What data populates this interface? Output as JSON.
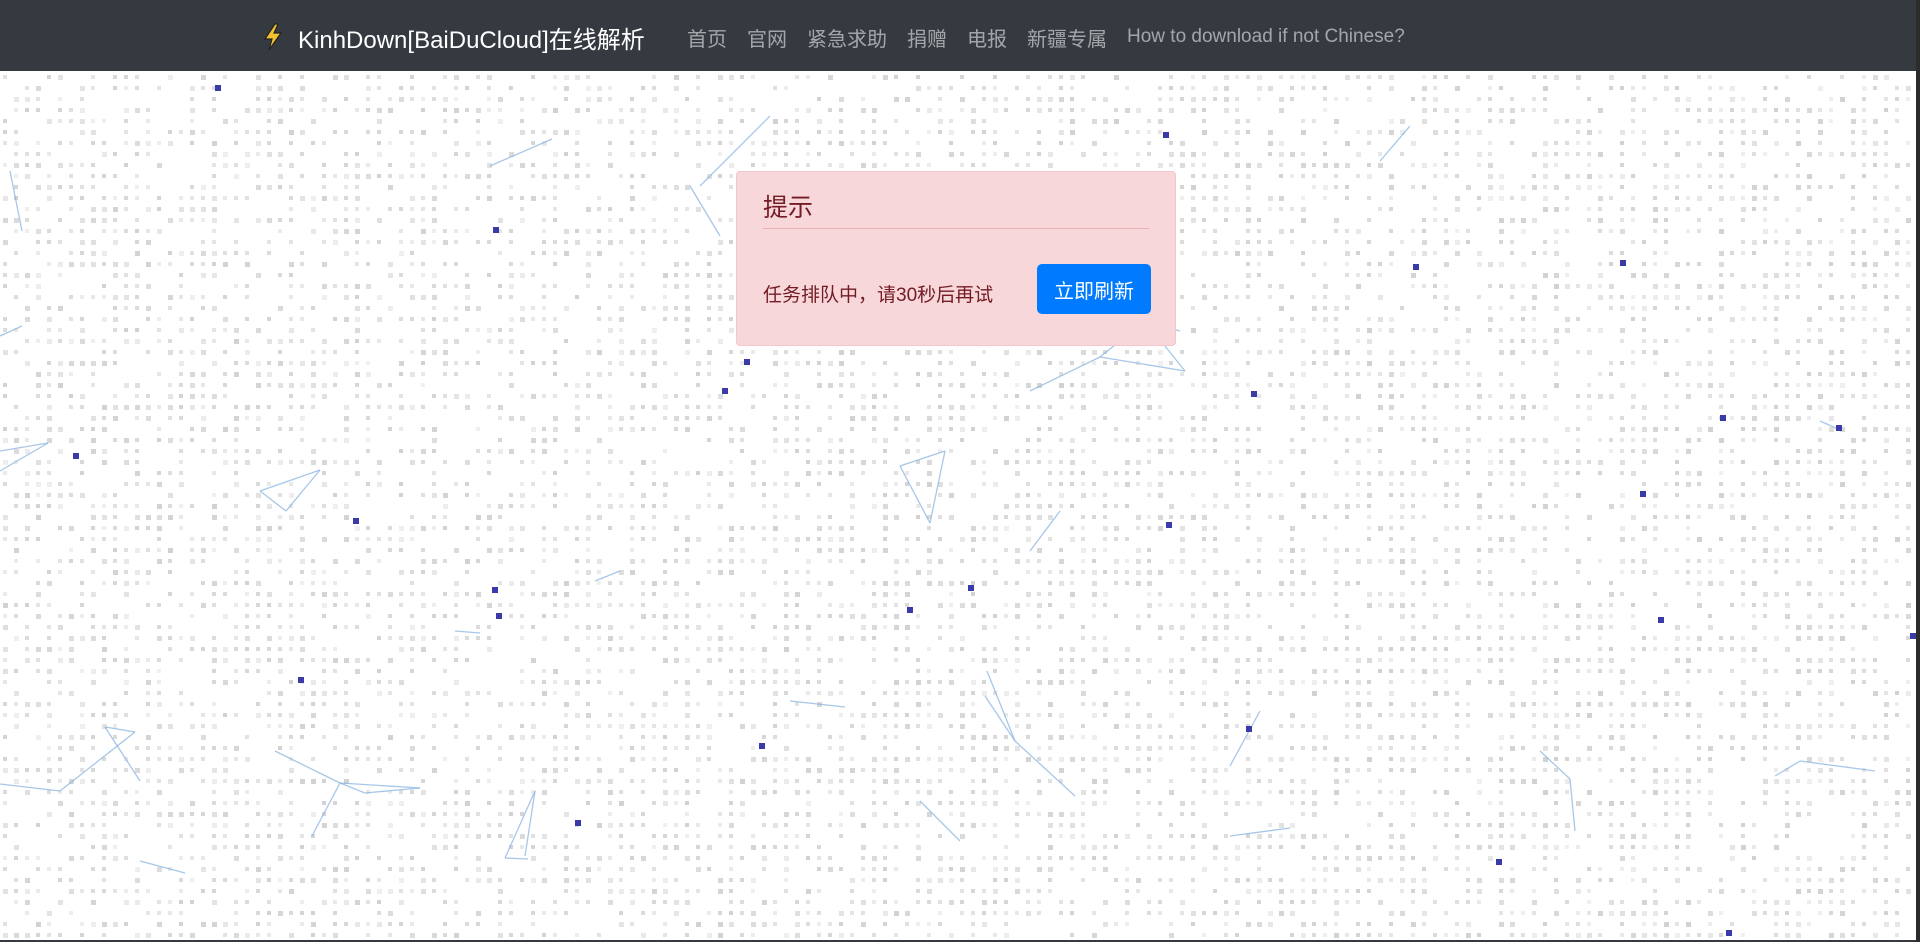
{
  "navbar": {
    "brand": "KinhDown[BaiDuCloud]在线解析",
    "logo_icon": "lightning-bolt-icon",
    "links": [
      {
        "label": "首页"
      },
      {
        "label": "官网"
      },
      {
        "label": "紧急求助"
      },
      {
        "label": "捐赠"
      },
      {
        "label": "电报"
      },
      {
        "label": "新疆专属"
      },
      {
        "label": "How to download if not Chinese?"
      }
    ]
  },
  "alert": {
    "heading": "提示",
    "message": "任务排队中，请30秒后再试",
    "button_label": "立即刷新"
  },
  "colors": {
    "navbar_bg": "#343a40",
    "alert_bg": "#f8d7da",
    "alert_text": "#721c24",
    "button_bg": "#007bff",
    "particle": "#3a3aa8"
  }
}
